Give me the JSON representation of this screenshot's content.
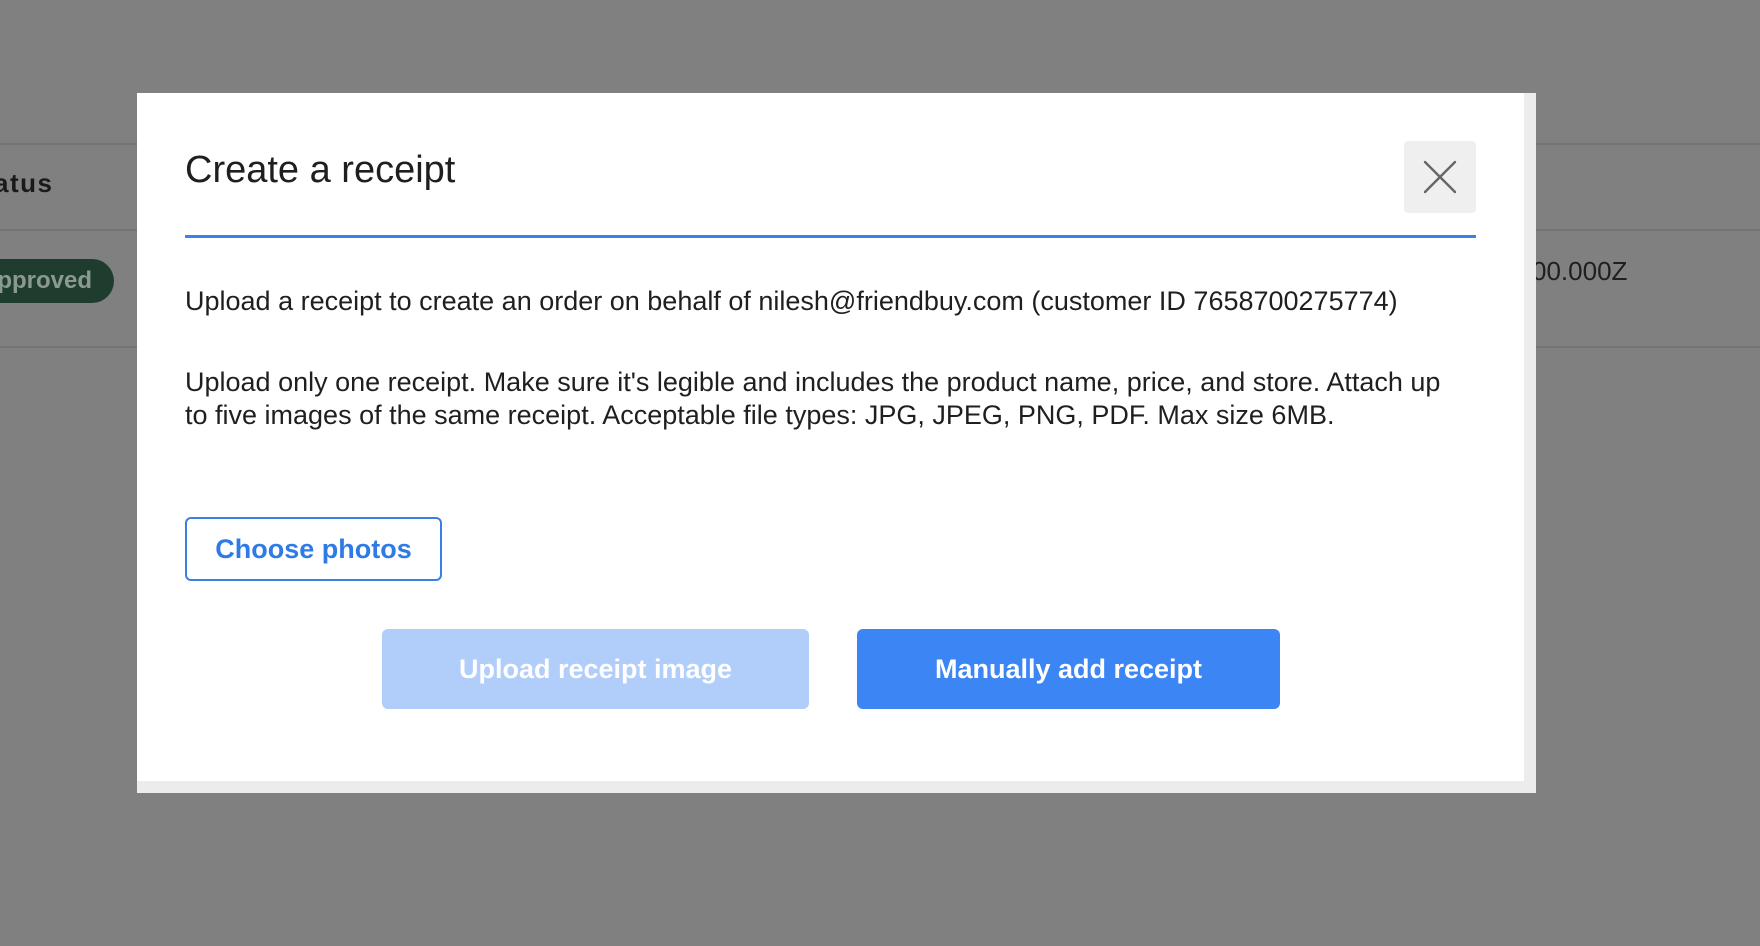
{
  "background": {
    "table_header_fragment": "atus",
    "status_badge": "pproved",
    "timestamp_fragment": "00.000Z"
  },
  "modal": {
    "title": "Create a receipt",
    "close_icon": "close-icon",
    "intro_text": "Upload a receipt to create an order on behalf of nilesh@friendbuy.com (customer ID 7658700275774)",
    "instructions_text": "Upload only one receipt. Make sure it's legible and includes the product name, price, and store. Attach up to five images of the same receipt. Acceptable file types: JPG, JPEG, PNG, PDF. Max size 6MB.",
    "choose_photos_label": "Choose photos",
    "upload_receipt_label": "Upload receipt image",
    "manual_add_label": "Manually add receipt"
  },
  "colors": {
    "overlay": "#808080",
    "accent": "#3b85f5",
    "accent_disabled": "#b1cdf9",
    "badge_bg": "#1f3d2f"
  }
}
